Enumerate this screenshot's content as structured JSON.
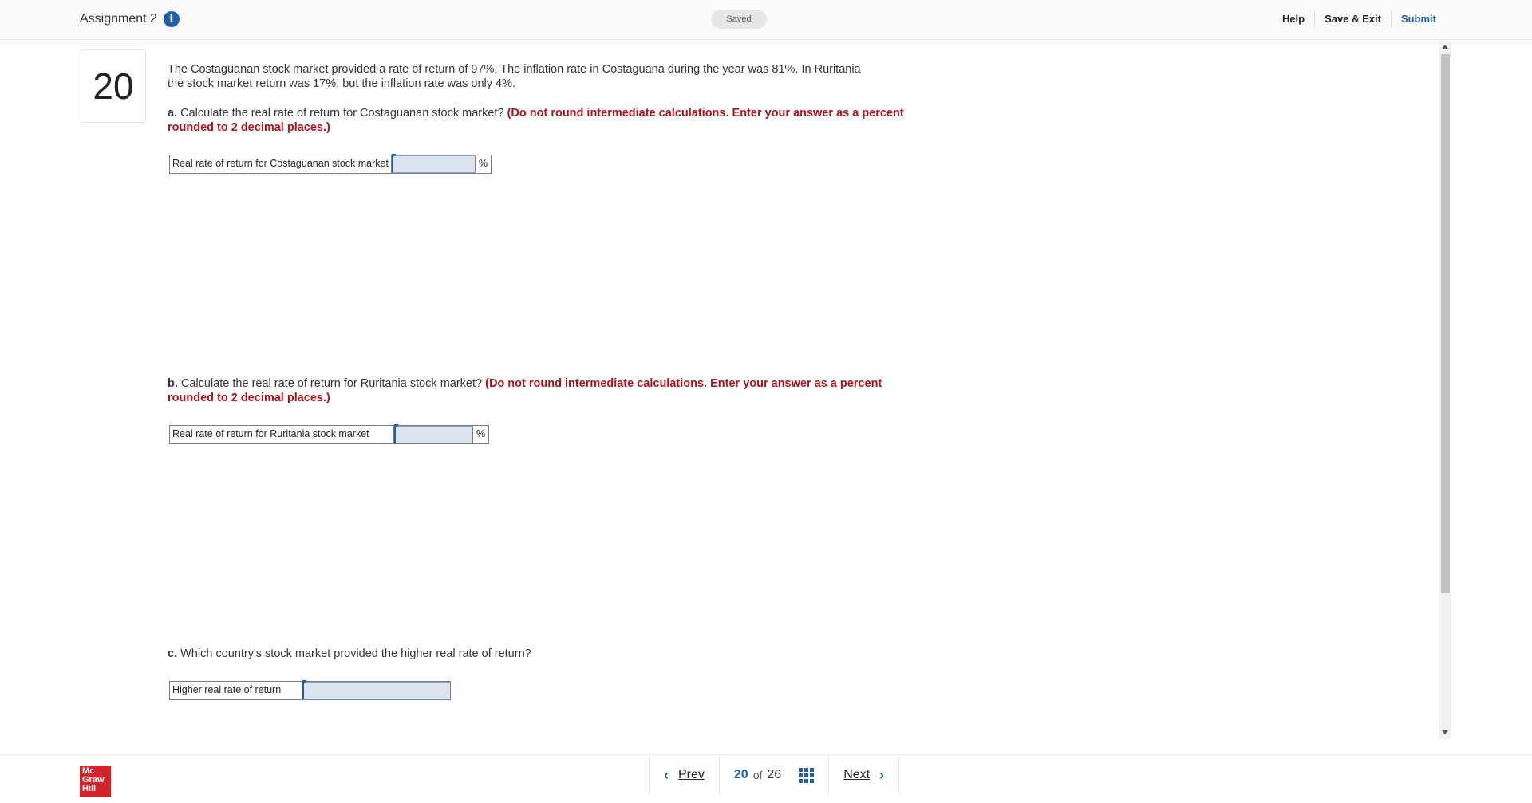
{
  "header": {
    "assignment_title": "Assignment 2",
    "saved_status": "Saved",
    "help_label": "Help",
    "save_exit_label": "Save & Exit",
    "submit_label": "Submit"
  },
  "question": {
    "number": "20",
    "stem_line1": "The Costaguanan stock market provided a rate of return of 97%. The inflation rate in Costaguana during the year was 81%. In Ruritania",
    "stem_line2": "the stock market return was 17%, but the inflation rate was only 4%.",
    "parts": [
      {
        "letter": "a.",
        "prompt": "Calculate the real rate of return for Costaguanan stock market?",
        "instruction": "(Do not round intermediate calculations. Enter your answer as a percent rounded to 2 decimal places.)",
        "answer_label": "Real rate of return for Costaguanan stock market",
        "answer_value": "",
        "unit": "%"
      },
      {
        "letter": "b.",
        "prompt": "Calculate the real rate of return for Ruritania stock market?",
        "instruction": "(Do not round intermediate calculations. Enter your answer as a percent rounded to 2 decimal places.)",
        "answer_label": "Real rate of return for Ruritania stock market",
        "answer_value": "",
        "unit": "%"
      },
      {
        "letter": "c.",
        "prompt": "Which country's stock market provided the higher real rate of return?",
        "answer_label": "Higher real rate of return",
        "answer_value": ""
      }
    ]
  },
  "footer": {
    "logo_line1": "Mc",
    "logo_line2": "Graw",
    "logo_line3": "Hill",
    "prev_label": "Prev",
    "current_page": "20",
    "of_label": "of",
    "total_pages": "26",
    "next_label": "Next"
  },
  "colors": {
    "accent": "#1f5ea8",
    "instruction_red": "#b0141a",
    "brand_red": "#d2232a",
    "input_fill": "#dde3ee"
  }
}
